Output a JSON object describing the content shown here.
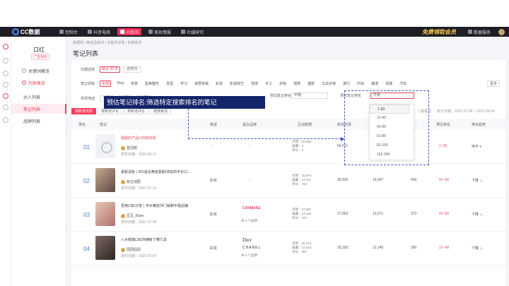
{
  "topbar": {
    "logo": "CC数据",
    "nav": [
      {
        "label": "控制台",
        "active": false
      },
      {
        "label": "抖音电商",
        "active": false
      },
      {
        "label": "小红书",
        "active": true
      },
      {
        "label": "美妆情报",
        "active": false
      },
      {
        "label": "社媒研究",
        "active": false
      }
    ],
    "promo": "免费领取会员",
    "data_service": "数据服务"
  },
  "sidebar": {
    "title": "口红",
    "badge": "广告询价",
    "items": [
      {
        "label": "关键词概览",
        "type": "item"
      },
      {
        "label": "列表概览",
        "type": "group"
      },
      {
        "label": "达人列表",
        "type": "child"
      },
      {
        "label": "笔记列表",
        "type": "active"
      },
      {
        "label": "品牌列表",
        "type": "child"
      }
    ]
  },
  "main": {
    "breadcrumb": "数据网 / 美妆品牌间 / 关键词详情 / 列表概览",
    "title": "笔记列表",
    "date_row": {
      "label": "日期选择",
      "chip": "最近 30 天",
      "select": "自然月"
    },
    "channel_row": {
      "label": "笔记领域",
      "tags": [
        "全部",
        "Vlog",
        "体育",
        "医美整形",
        "发型",
        "学习",
        "家居家装",
        "彩妆",
        "影视综艺",
        "情感",
        "手工",
        "护肤",
        "搞笑",
        "摄影",
        "文具手账",
        "旅行",
        "时尚",
        "萌宠",
        "母婴",
        "汽车"
      ],
      "more": "更多"
    },
    "tag_row": {
      "label": "常规筛选",
      "items": [
        "不限",
        "不限",
        "不限"
      ]
    },
    "sort": {
      "label": "预估笔记排名",
      "value": "不限"
    },
    "rank": {
      "label": "预估笔记排名",
      "value": "不限"
    },
    "tabs": [
      "按新增点赞",
      "按新增评论",
      "按新增评论",
      "按搜索词"
    ],
    "count": "1 篇笔记",
    "stat_date": "统计日期：2021-07-06 ~ 2021-08-04"
  },
  "table": {
    "headers": [
      "排名",
      "笔记",
      "频道",
      "提及品牌",
      "互动数据",
      "新增点赞",
      "新",
      "预估排名",
      "排名趋势"
    ],
    "rows": [
      {
        "rank": "01",
        "title": "戳戳的产品口红制造机",
        "title_red": true,
        "author": "皇冠鹅",
        "pub": "发布日期：2020-06-17",
        "channel": "-",
        "brand": "-",
        "interact": [
          "点赞：15,069",
          "收藏：0",
          "评论：0"
        ],
        "likes": "54,571",
        "col2": "",
        "col3": "",
        "range": "1~20",
        "trend": "持平",
        "trend_arrow": "▾"
      },
      {
        "rank": "02",
        "title": "素颜试色丨8只适合黄皮素颜/浓妆的平价口...",
        "title_red": false,
        "author": "有位减肥",
        "pub": "发布日期：2021-07-21",
        "channel": "彩妆",
        "brand": "-",
        "interact": [
          "点赞：31,070",
          "收藏：14,757",
          "评论：703"
        ],
        "likes": "30,625",
        "col2": "14,547",
        "col3": "699",
        "range": "41~60",
        "trend": "下降",
        "trend_arrow": "↘"
      },
      {
        "rank": "03",
        "title": "爱用口红分享丨平价黄皮冲门就刷不看后悔",
        "title_red": false,
        "author": "豆豆_Babe",
        "pub": "发布日期：2021-07-06",
        "channel": "彩妆",
        "brand": "共 4 个品牌",
        "brand_logo": "CANMAKE",
        "interact": [
          "点赞：27,997",
          "收藏：13,125",
          "评论：377"
        ],
        "likes": "27,862",
        "col2": "13,071",
        "col3": "373",
        "range": "41~60",
        "trend": "下降",
        "trend_arrow": "↘"
      },
      {
        "rank": "04",
        "title": "八大经典口红你拥有了哪几支",
        "title_red": false,
        "author": "团团妈妈",
        "pub": "发布日期：2021-07-07",
        "channel": "彩妆",
        "brand": "共 4 个品牌",
        "brand_logo": "Dior",
        "brand_logo2": "CHANEL",
        "interact": [
          "点赞：18,714",
          "收藏：12,519",
          "评论：307"
        ],
        "likes": "18,303",
        "col2": "12,245",
        "col3": "300",
        "range": "21~40",
        "trend": "下降",
        "trend_arrow": "↘"
      }
    ]
  },
  "overlay": {
    "banner": "预估笔记排名:筛选特定搜索排名的笔记",
    "dropdown": [
      "1-20",
      "21-40",
      "41-60",
      "61-80",
      "81-100",
      "101-200"
    ]
  },
  "colors": {
    "accent": "#e8455c",
    "banner": "#13246a",
    "rank": "#4a78d8"
  }
}
